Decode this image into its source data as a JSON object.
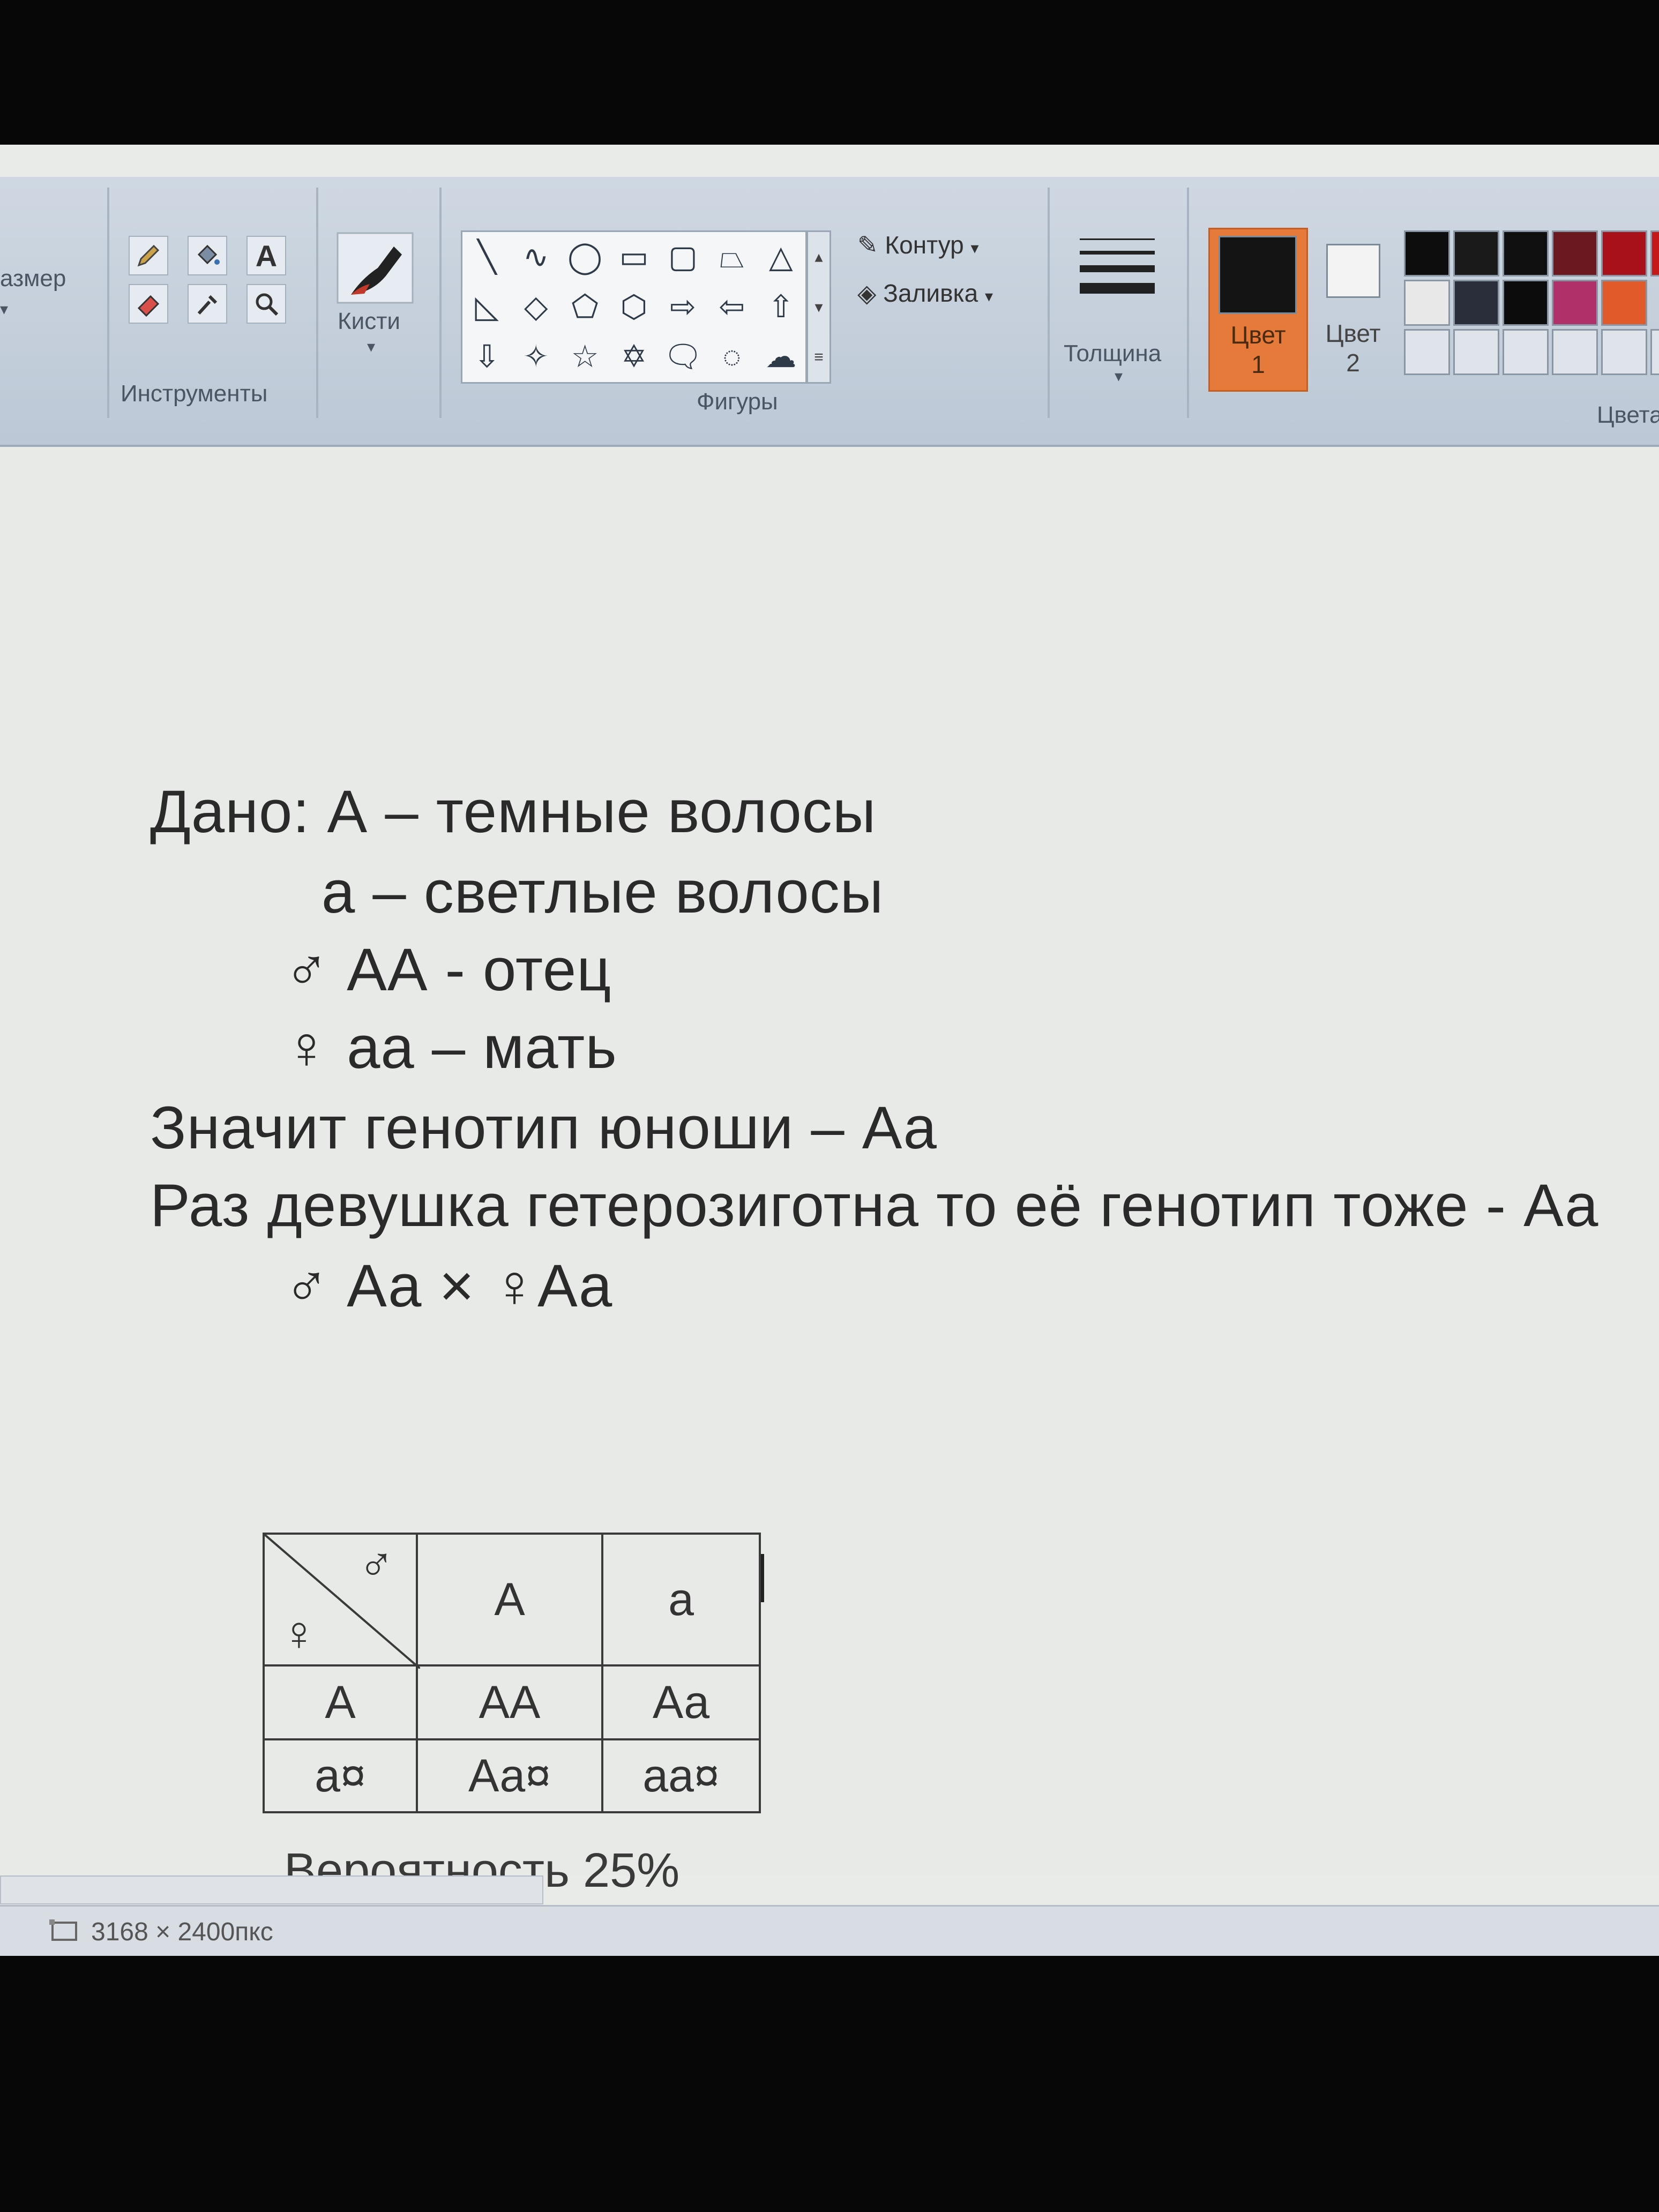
{
  "ribbon": {
    "size_label": "азмер",
    "tools_label": "Инструменты",
    "brushes_label": "Кисти",
    "shapes_label": "Фигуры",
    "outline_label": "Контур",
    "fill_label": "Заливка",
    "thickness_label": "Толщина",
    "color1_label": "Цвет",
    "color1_num": "1",
    "color2_label": "Цвет",
    "color2_num": "2",
    "colors_label": "Цвета",
    "color1_value": "#141414",
    "color2_value": "#f3f3f3",
    "palette": [
      [
        "#0d0d0d",
        "#1a1a1a",
        "#101010",
        "#6b1820",
        "#a8101a",
        "#c51818"
      ],
      [
        "#e8e8e8",
        "#2a2e3a",
        "#0c0c0c",
        "#b0306a",
        "#e05a2a"
      ],
      [
        "#dfe4ea",
        "#dfe4ea",
        "#dfe4ea",
        "#dfe4ea",
        "#dfe4ea",
        "#dfe4ea"
      ]
    ]
  },
  "document": {
    "line1": "Дано: А – темные волосы",
    "line2": "а – светлые волосы",
    "line3": "♂ АА - отец",
    "line4": "♀ аа – мать",
    "line5": "Значит генотип юноши –  Аа",
    "line6": "Раз девушка гетерозиготна то её генотип тоже - Аа",
    "line7": "♂ Аа × ♀Аа",
    "punnett": {
      "male_symbol": "♂",
      "female_symbol": "♀",
      "col_headers": [
        "А",
        "а"
      ],
      "rows": [
        {
          "header": "А",
          "cells": [
            "АА",
            "Аа"
          ]
        },
        {
          "header": "а¤",
          "cells": [
            "Аа¤",
            "аа¤"
          ]
        }
      ]
    },
    "probability": "Вероятность  25%"
  },
  "status": {
    "size": "3168 × 2400пкс"
  }
}
